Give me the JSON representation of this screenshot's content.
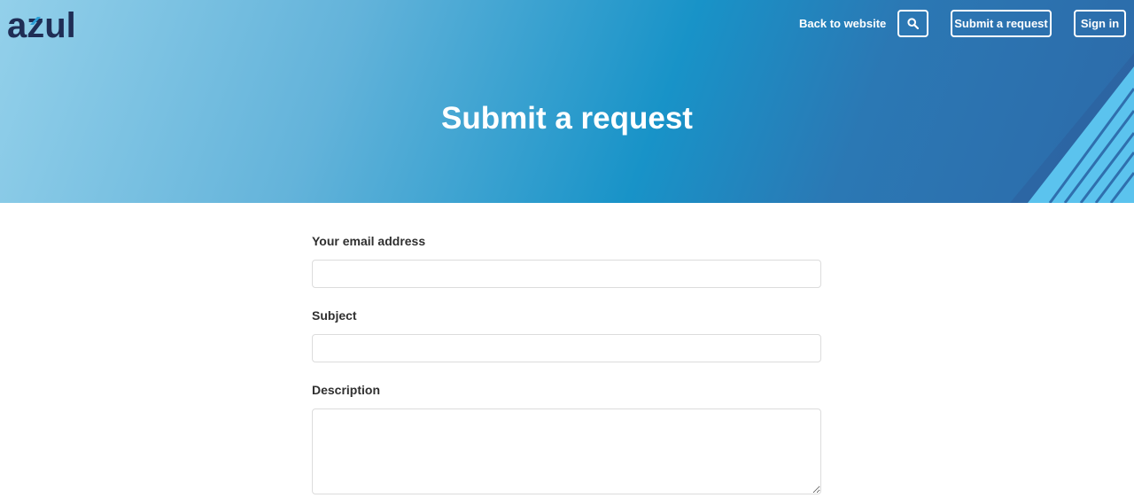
{
  "brand": {
    "logo_text": "azul",
    "logo_color": "#1f2d55",
    "logo_accent": "#2a9fd6"
  },
  "nav": {
    "back_label": "Back to website",
    "search_icon": "search-icon",
    "submit_label": "Submit a request",
    "signin_label": "Sign in"
  },
  "hero": {
    "title": "Submit a request"
  },
  "form": {
    "email_label": "Your email address",
    "email_value": "",
    "subject_label": "Subject",
    "subject_value": "",
    "description_label": "Description",
    "description_value": ""
  },
  "colors": {
    "hero_start": "#93d0ea",
    "hero_mid": "#1893c8",
    "hero_end": "#2d6aa9",
    "stripe": "#5bc3ee"
  }
}
